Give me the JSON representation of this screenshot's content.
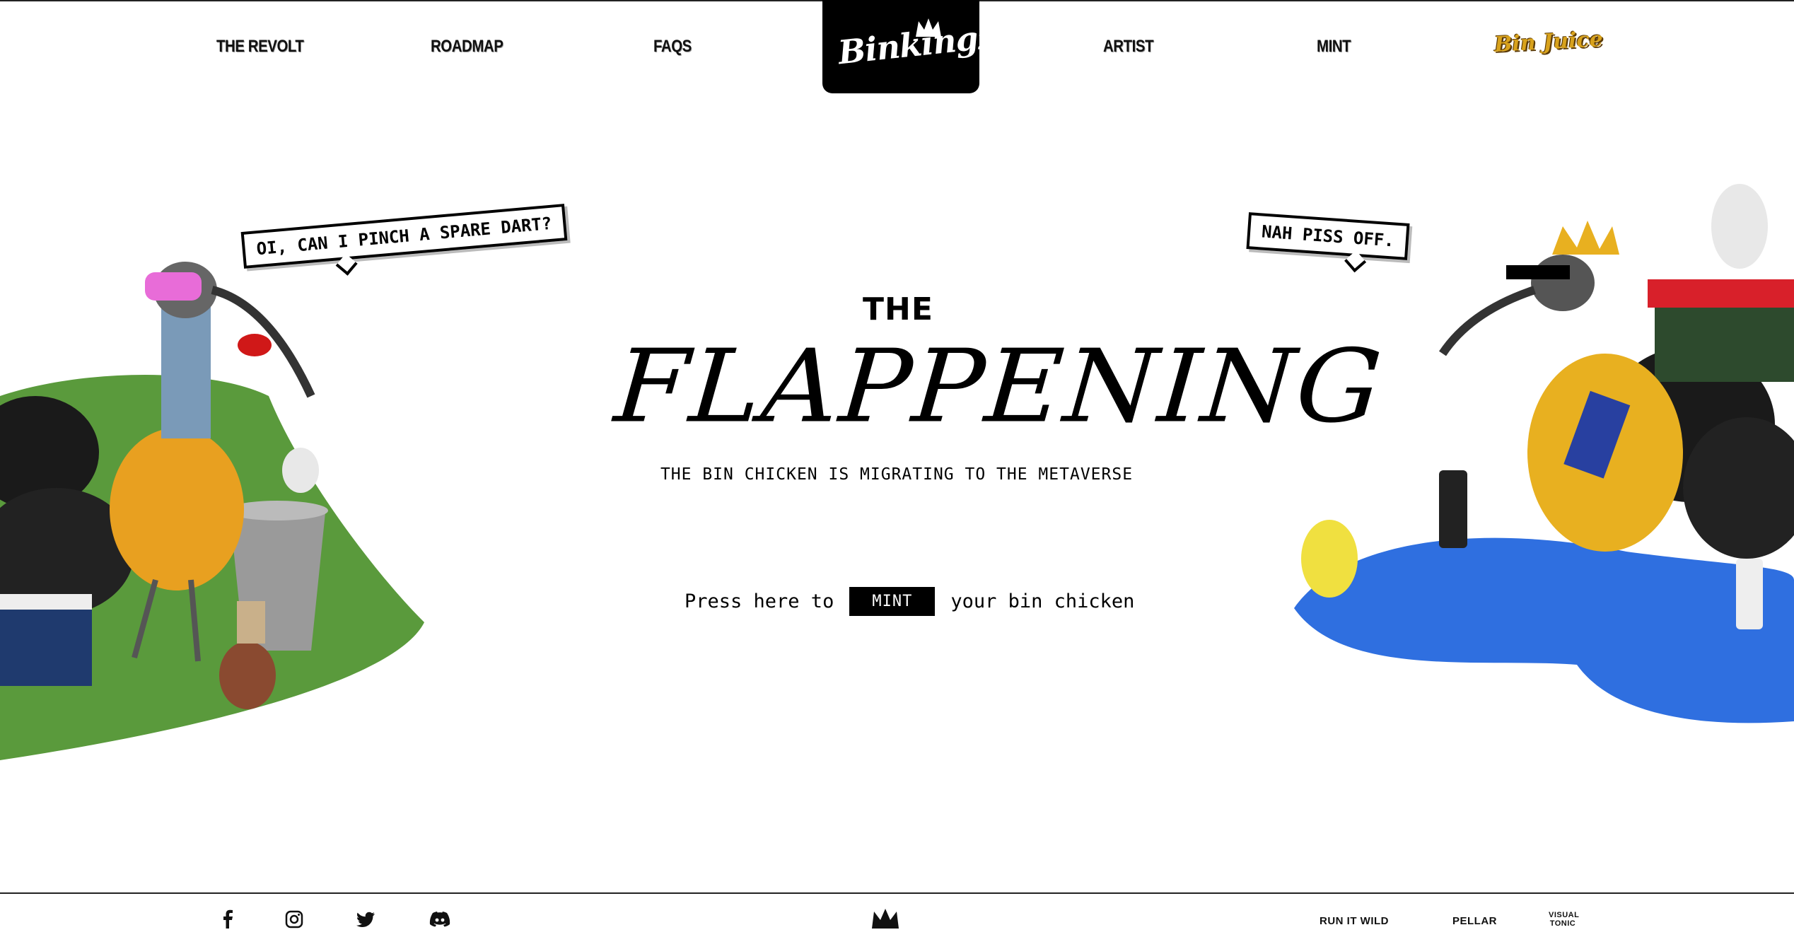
{
  "nav": {
    "left": [
      "THE REVOLT",
      "ROADMAP",
      "FAQS"
    ],
    "right": [
      "ARTIST",
      "MINT"
    ],
    "logo": "Binkingz",
    "juice": "Bin Juice"
  },
  "hero": {
    "pre_title": "THE",
    "title": "FLAPPENING",
    "subtitle": "THE BIN CHICKEN IS MIGRATING TO THE METAVERSE",
    "mint_prefix": "Press here to",
    "mint_button": "MINT",
    "mint_suffix": "your bin chicken"
  },
  "bubbles": {
    "left": "OI, CAN I PINCH A SPARE DART?",
    "right": "NAH PISS OFF."
  },
  "footer": {
    "social_icons": [
      "facebook-icon",
      "instagram-icon",
      "twitter-icon",
      "discord-icon"
    ],
    "partners": [
      "RUN IT WILD",
      "PELLAR",
      "VISUAL TONIC"
    ]
  },
  "colors": {
    "background": "#ffffff",
    "accent": "#000000",
    "grass": "#5a9a3c",
    "puddle": "#2f6fe0",
    "juice": "#d8a21c"
  }
}
